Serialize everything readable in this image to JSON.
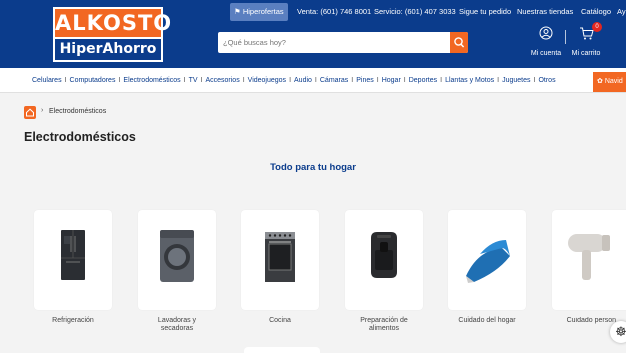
{
  "brand": {
    "logo_top": "ALKOSTO",
    "logo_bottom": "HiperAhorro",
    "orange": "#f26722",
    "blue": "#0b3c8c"
  },
  "topbar": {
    "hiperofertas": "Hiperofertas",
    "venta": "Venta: (601) 746 8001",
    "servicio": "Servicio: (601) 407 3033",
    "pedido": "Sigue tu pedido",
    "tiendas": "Nuestras tiendas",
    "catalogo": "Catálogo",
    "ayuda": "Ay"
  },
  "search": {
    "placeholder": "¿Qué buscas hoy?",
    "icon": "search-icon"
  },
  "account": {
    "cuenta": "Mi cuenta",
    "carrito": "Mi carrito",
    "cart_count": "0"
  },
  "categories": [
    "Celulares",
    "Computadores",
    "Electrodomésticos",
    "TV",
    "Accesorios",
    "Videojuegos",
    "Audio",
    "Cámaras",
    "Pines",
    "Hogar",
    "Deportes",
    "Llantas y Motos",
    "Juguetes",
    "Otros"
  ],
  "navidad_label": "Navid",
  "breadcrumb": {
    "current": "Electrodomésticos"
  },
  "page_title": "Electrodomésticos",
  "section_title": "Todo para tu hogar",
  "cards": [
    {
      "line1": "Refrigeración",
      "line2": "",
      "icon": "refrigerator-icon"
    },
    {
      "line1": "Lavadoras y",
      "line2": "secadoras",
      "icon": "washing-machine-icon"
    },
    {
      "line1": "Cocina",
      "line2": "",
      "icon": "stove-icon"
    },
    {
      "line1": "Preparación de",
      "line2": "alimentos",
      "icon": "air-fryer-icon"
    },
    {
      "line1": "Cuidado del hogar",
      "line2": "",
      "icon": "iron-icon"
    },
    {
      "line1": "Cuidado person",
      "line2": "",
      "icon": "hair-dryer-icon"
    }
  ]
}
